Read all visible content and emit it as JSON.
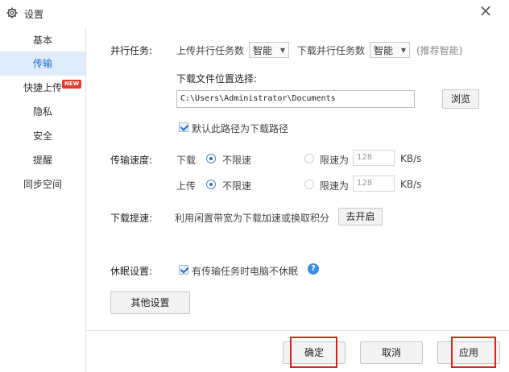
{
  "window": {
    "title": "设置",
    "close_glyph": "×"
  },
  "sidebar": {
    "items": [
      {
        "label": "基本"
      },
      {
        "label": "传输"
      },
      {
        "label": "快捷上传",
        "badge": "NEW"
      },
      {
        "label": "隐私"
      },
      {
        "label": "安全"
      },
      {
        "label": "提醒"
      },
      {
        "label": "同步空间"
      }
    ],
    "active_index": 1
  },
  "parallel": {
    "label": "并行任务:",
    "upload_label": "上传并行任务数",
    "upload_value": "智能",
    "download_label": "下载并行任务数",
    "download_value": "智能",
    "hint": "(推荐智能)"
  },
  "download_location": {
    "label": "下载文件位置选择:",
    "path": "C:\\Users\\Administrator\\Documents",
    "browse_label": "浏览",
    "default_checkbox_label": "默认此路径为下载路径",
    "default_checked": true
  },
  "speed": {
    "label": "传输速度:",
    "download": {
      "label": "下载",
      "unlimited_label": "不限速",
      "limit_label": "限速为",
      "limit_value": "128",
      "unit": "KB/s",
      "selected": "unlimited"
    },
    "upload": {
      "label": "上传",
      "unlimited_label": "不限速",
      "limit_label": "限速为",
      "limit_value": "128",
      "unit": "KB/s",
      "selected": "unlimited"
    }
  },
  "boost": {
    "label": "下载提速:",
    "desc": "利用闲置带宽为下载加速或换取积分",
    "button_label": "去开启"
  },
  "sleep": {
    "label": "休眠设置:",
    "checkbox_label": "有传输任务时电脑不休眠",
    "checked": true,
    "help_glyph": "?"
  },
  "other_button_label": "其他设置",
  "footer": {
    "ok_label": "确定",
    "cancel_label": "取消",
    "apply_label": "应用"
  },
  "colors": {
    "accent": "#1b6ac9",
    "highlight_box": "#e0201c",
    "active_bg": "#e0ecfb"
  }
}
